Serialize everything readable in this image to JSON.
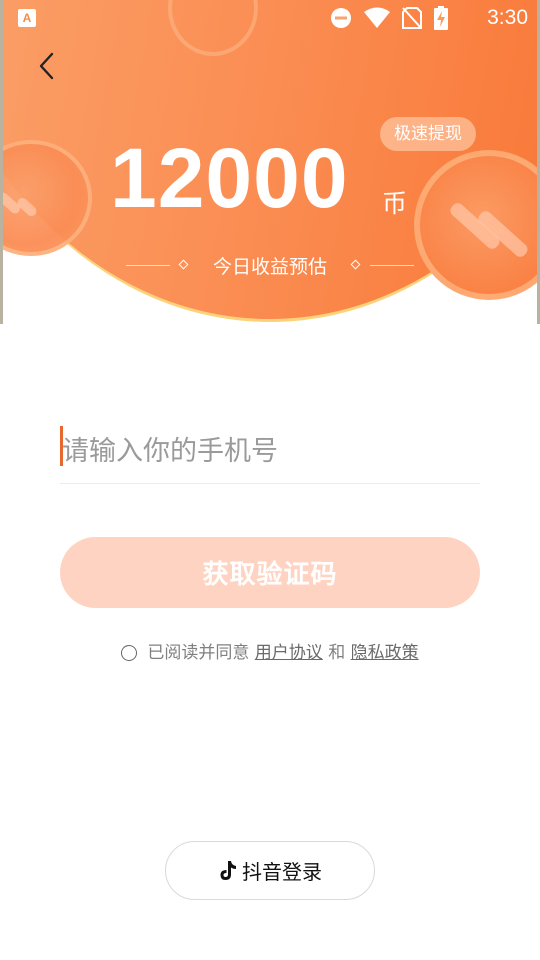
{
  "status_bar": {
    "time": "3:30",
    "app_icon_letter": "A",
    "icons": [
      "do-not-disturb-icon",
      "wifi-icon",
      "no-sim-icon",
      "battery-charging-icon"
    ]
  },
  "hero": {
    "badge": "极速提现",
    "amount": "12000",
    "unit": "币",
    "subtitle": "今日收益预估"
  },
  "login": {
    "phone_placeholder": "请输入你的手机号",
    "phone_value": "",
    "get_code_label": "获取验证码",
    "agree_checked": false,
    "agree_prefix": "已阅读并同意",
    "user_agreement": "用户协议",
    "and": "和",
    "privacy_policy": "隐私政策"
  },
  "douyin": {
    "label": "抖音登录"
  },
  "colors": {
    "accent": "#fb8f55",
    "button_disabled": "#ffd3c1",
    "cursor": "#e8692f"
  }
}
